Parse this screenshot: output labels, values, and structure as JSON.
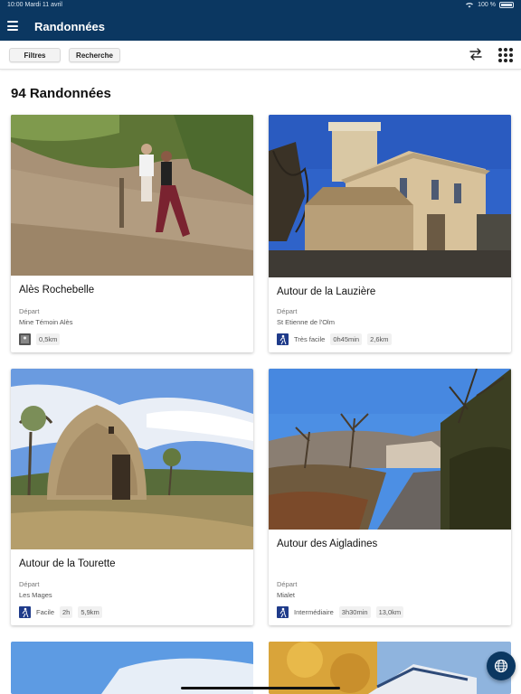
{
  "status_bar": {
    "time": "10:00",
    "date": "Mardi 11 avril",
    "battery": "100 %"
  },
  "header": {
    "title": "Randonnées",
    "menu_icon": "hamburger-menu-icon"
  },
  "toolbar": {
    "filters_label": "Filtres",
    "search_label": "Recherche",
    "swap_icon": "swap-arrows-icon",
    "grid_icon": "grid-view-icon"
  },
  "results": {
    "count_label": "94 Randonnées"
  },
  "hikes": [
    {
      "title": "Alès Rochebelle",
      "start_label": "Départ",
      "start_value": "Mine Témoin Alès",
      "difficulty_icon": "difficulty-icon",
      "difficulty": "",
      "duration": "",
      "distance": "0,5km"
    },
    {
      "title": "Autour de la Lauzière",
      "start_label": "Départ",
      "start_value": "St Etienne de l'Olm",
      "difficulty_icon": "hiker-icon",
      "difficulty": "Très facile",
      "duration": "0h45min",
      "distance": "2,6km"
    },
    {
      "title": "Autour de la Tourette",
      "start_label": "Départ",
      "start_value": "Les Mages",
      "difficulty_icon": "hiker-icon",
      "difficulty": "Facile",
      "duration": "2h",
      "distance": "5,9km"
    },
    {
      "title": "Autour des Aigladines",
      "start_label": "Départ",
      "start_value": "Mialet",
      "difficulty_icon": "hiker-icon",
      "difficulty": "Intermédiaire",
      "duration": "3h30min",
      "distance": "13,0km"
    }
  ],
  "fab": {
    "icon": "globe-icon"
  },
  "colors": {
    "header": "#0b3761",
    "accent": "#1f3b8a"
  }
}
